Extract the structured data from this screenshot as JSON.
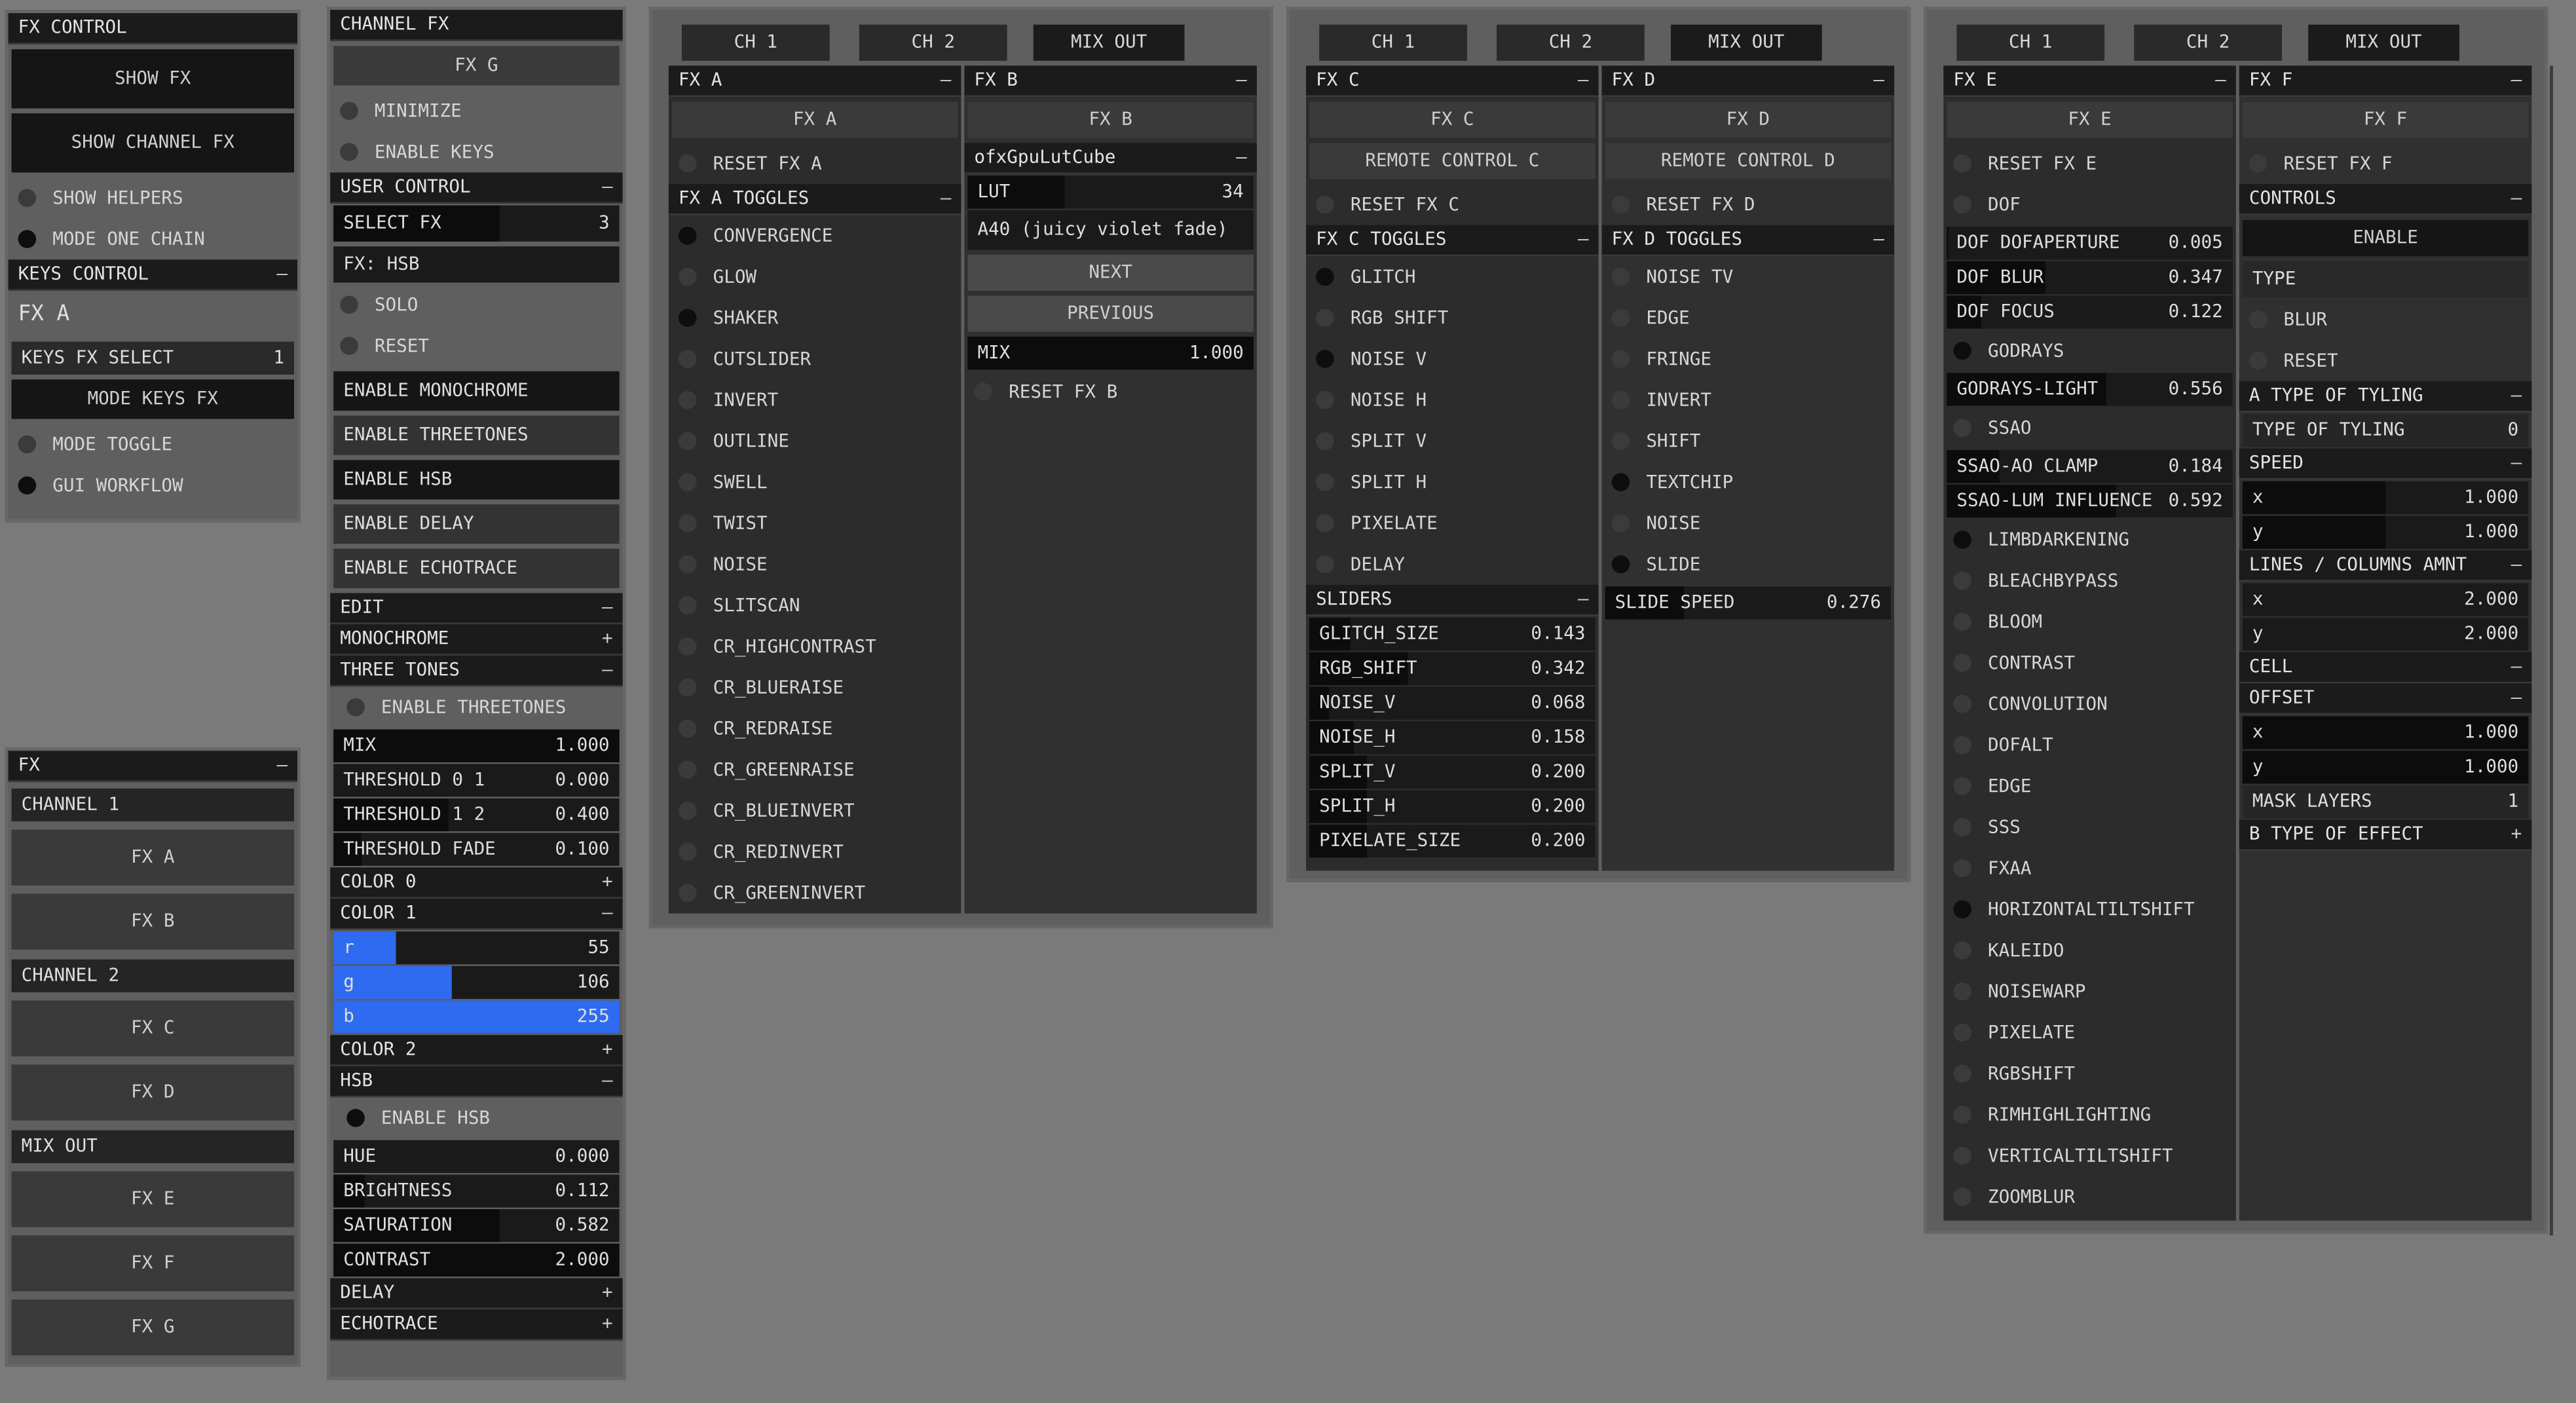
{
  "fx_control": {
    "title": "FX CONTROL",
    "show_fx": "SHOW FX",
    "show_channel_fx": "SHOW CHANNEL FX",
    "show_helpers": "SHOW HELPERS",
    "mode_one_chain": "MODE ONE CHAIN",
    "keys_control": "KEYS CONTROL",
    "keys_control_sign": "–",
    "fx_a_label": "FX A",
    "keys_fx_select": {
      "label": "KEYS FX SELECT",
      "value": "1"
    },
    "mode_keys_fx": "MODE KEYS FX",
    "mode_toggle": "MODE TOGGLE",
    "gui_workflow": "GUI WORKFLOW"
  },
  "fx_panel": {
    "title": "FX",
    "sign": "–",
    "channel_1": "CHANNEL 1",
    "fx_a": "FX A",
    "fx_b": "FX B",
    "channel_2": "CHANNEL 2",
    "fx_c": "FX C",
    "fx_d": "FX D",
    "mix_out": "MIX OUT",
    "fx_e": "FX E",
    "fx_f": "FX F",
    "fx_g": "FX G"
  },
  "channel_fx": {
    "title": "CHANNEL FX",
    "fx_g": "FX G",
    "minimize": "MINIMIZE",
    "enable_keys": "ENABLE KEYS",
    "user_control": "USER CONTROL",
    "user_control_sign": "–",
    "select_fx": {
      "label": "SELECT FX",
      "value": "3"
    },
    "fx_hsb": "FX: HSB",
    "solo": "SOLO",
    "reset": "RESET",
    "enable_monochrome": "ENABLE MONOCHROME",
    "enable_threetones": "ENABLE THREETONES",
    "enable_hsb": "ENABLE HSB",
    "enable_delay": "ENABLE DELAY",
    "enable_echotrace": "ENABLE ECHOTRACE",
    "edit": "EDIT",
    "edit_sign": "–",
    "monochrome": "MONOCHROME",
    "monochrome_sign": "+",
    "three_tones": "THREE TONES",
    "three_tones_sign": "–",
    "enable_threetones_toggle": "ENABLE THREETONES",
    "mix": {
      "label": "MIX",
      "value": "1.000",
      "fill": 1.0
    },
    "threshold01": {
      "label": "THRESHOLD 0 1",
      "value": "0.000",
      "fill": 0.0
    },
    "threshold12": {
      "label": "THRESHOLD 1 2",
      "value": "0.400",
      "fill": 0.4
    },
    "threshold_fade": {
      "label": "THRESHOLD FADE",
      "value": "0.100",
      "fill": 0.1
    },
    "color0": "COLOR 0",
    "color0_sign": "+",
    "color1": "COLOR 1",
    "color1_sign": "–",
    "r": {
      "label": "r",
      "value": "55",
      "fill": 0.216
    },
    "g": {
      "label": "g",
      "value": "106",
      "fill": 0.416
    },
    "b": {
      "label": "b",
      "value": "255",
      "fill": 1.0
    },
    "color2": "COLOR 2",
    "color2_sign": "+",
    "hsb": "HSB",
    "hsb_sign": "–",
    "enable_hsb_toggle": "ENABLE HSB",
    "hue": {
      "label": "HUE",
      "value": "0.000",
      "fill": 0.0
    },
    "brightness": {
      "label": "BRIGHTNESS",
      "value": "0.112",
      "fill": 0.112
    },
    "saturation": {
      "label": "SATURATION",
      "value": "0.582",
      "fill": 0.582
    },
    "contrast": {
      "label": "CONTRAST",
      "value": "2.000",
      "fill": 1.0
    },
    "delay": "DELAY",
    "delay_sign": "+",
    "echotrace": "ECHOTRACE",
    "echotrace_sign": "+"
  },
  "tabs": {
    "ch1": "CH 1",
    "ch2": "CH 2",
    "mixout": "MIX OUT"
  },
  "fxa": {
    "title": "FX A",
    "sign": "–",
    "button": "FX A",
    "reset": "RESET FX A",
    "toggles_title": "FX A TOGGLES",
    "toggles_sign": "–",
    "toggles": [
      {
        "label": "CONVERGENCE",
        "on": true
      },
      {
        "label": "GLOW",
        "on": false
      },
      {
        "label": "SHAKER",
        "on": true
      },
      {
        "label": "CUTSLIDER",
        "on": false
      },
      {
        "label": "INVERT",
        "on": false
      },
      {
        "label": "OUTLINE",
        "on": false
      },
      {
        "label": "SWELL",
        "on": false
      },
      {
        "label": "TWIST",
        "on": false
      },
      {
        "label": "NOISE",
        "on": false
      },
      {
        "label": "SLITSCAN",
        "on": false
      },
      {
        "label": "CR_HIGHCONTRAST",
        "on": false
      },
      {
        "label": "CR_BLUERAISE",
        "on": false
      },
      {
        "label": "CR_REDRAISE",
        "on": false
      },
      {
        "label": "CR_GREENRAISE",
        "on": false
      },
      {
        "label": "CR_BLUEINVERT",
        "on": false
      },
      {
        "label": "CR_REDINVERT",
        "on": false
      },
      {
        "label": "CR_GREENINVERT",
        "on": false
      }
    ]
  },
  "fxb": {
    "title": "FX B",
    "sign": "–",
    "button": "FX B",
    "lut_cube": "ofxGpuLutCube",
    "lut_cube_sign": "–",
    "lut": {
      "label": "LUT",
      "value": "34",
      "fill": 0.34
    },
    "lut_name": "A40 (juicy violet fade)",
    "next": "NEXT",
    "previous": "PREVIOUS",
    "mix": {
      "label": "MIX",
      "value": "1.000",
      "fill": 1.0
    },
    "reset": "RESET FX B"
  },
  "fxc": {
    "title": "FX C",
    "sign": "–",
    "button": "FX C",
    "remote": "REMOTE CONTROL C",
    "reset": "RESET FX C",
    "toggles_title": "FX C TOGGLES",
    "toggles_sign": "–",
    "toggles": [
      {
        "label": "GLITCH",
        "on": true
      },
      {
        "label": "RGB SHIFT",
        "on": false
      },
      {
        "label": "NOISE V",
        "on": true
      },
      {
        "label": "NOISE H",
        "on": false
      },
      {
        "label": "SPLIT V",
        "on": false
      },
      {
        "label": "SPLIT H",
        "on": false
      },
      {
        "label": "PIXELATE",
        "on": false
      },
      {
        "label": "DELAY",
        "on": false
      }
    ],
    "sliders_title": "SLIDERS",
    "sliders_sign": "–",
    "sliders": [
      {
        "label": "GLITCH_SIZE",
        "value": "0.143",
        "fill": 0.143
      },
      {
        "label": "RGB_SHIFT",
        "value": "0.342",
        "fill": 0.342
      },
      {
        "label": "NOISE_V",
        "value": "0.068",
        "fill": 0.068
      },
      {
        "label": "NOISE_H",
        "value": "0.158",
        "fill": 0.158
      },
      {
        "label": "SPLIT_V",
        "value": "0.200",
        "fill": 0.2
      },
      {
        "label": "SPLIT_H",
        "value": "0.200",
        "fill": 0.2
      },
      {
        "label": "PIXELATE_SIZE",
        "value": "0.200",
        "fill": 0.2
      }
    ]
  },
  "fxd": {
    "title": "FX D",
    "sign": "–",
    "button": "FX D",
    "remote": "REMOTE CONTROL D",
    "reset": "RESET FX D",
    "toggles_title": "FX D TOGGLES",
    "toggles_sign": "–",
    "toggles": [
      {
        "label": "NOISE TV",
        "on": false
      },
      {
        "label": "EDGE",
        "on": false
      },
      {
        "label": "FRINGE",
        "on": false
      },
      {
        "label": "INVERT",
        "on": false
      },
      {
        "label": "SHIFT",
        "on": false
      },
      {
        "label": "TEXTCHIP",
        "on": true
      },
      {
        "label": "NOISE",
        "on": false
      },
      {
        "label": "SLIDE",
        "on": true
      }
    ],
    "slide_speed": {
      "label": "SLIDE SPEED",
      "value": "0.276",
      "fill": 0.276
    }
  },
  "fxe": {
    "title": "FX E",
    "sign": "–",
    "button": "FX E",
    "reset": "RESET FX E",
    "dof": "DOF",
    "params1": [
      {
        "label": "DOF DOFAPERTURE",
        "value": "0.005",
        "fill": 0.005
      },
      {
        "label": "DOF BLUR",
        "value": "0.347",
        "fill": 0.347
      },
      {
        "label": "DOF FOCUS",
        "value": "0.122",
        "fill": 0.122
      }
    ],
    "godrays": "GODRAYS",
    "godrays_light": {
      "label": "GODRAYS-LIGHT",
      "value": "0.556",
      "fill": 0.556
    },
    "ssao": "SSAO",
    "params2": [
      {
        "label": "SSAO-AO CLAMP",
        "value": "0.184",
        "fill": 0.184
      },
      {
        "label": "SSAO-LUM INFLUENCE",
        "value": "0.592",
        "fill": 0.592
      }
    ],
    "toggles": [
      {
        "label": "LIMBDARKENING",
        "on": true
      },
      {
        "label": "BLEACHBYPASS",
        "on": false
      },
      {
        "label": "BLOOM",
        "on": false
      },
      {
        "label": "CONTRAST",
        "on": false
      },
      {
        "label": "CONVOLUTION",
        "on": false
      },
      {
        "label": "DOFALT",
        "on": false
      },
      {
        "label": "EDGE",
        "on": false
      },
      {
        "label": "SSS",
        "on": false
      },
      {
        "label": "FXAA",
        "on": false
      },
      {
        "label": "HORIZONTALTILTSHIFT",
        "on": true
      },
      {
        "label": "KALEIDO",
        "on": false
      },
      {
        "label": "NOISEWARP",
        "on": false
      },
      {
        "label": "PIXELATE",
        "on": false
      },
      {
        "label": "RGBSHIFT",
        "on": false
      },
      {
        "label": "RIMHIGHLIGHTING",
        "on": false
      },
      {
        "label": "VERTICALTILTSHIFT",
        "on": false
      },
      {
        "label": "ZOOMBLUR",
        "on": false
      }
    ]
  },
  "fxf": {
    "title": "FX F",
    "sign": "–",
    "button": "FX F",
    "reset": "RESET FX F",
    "controls": "CONTROLS",
    "controls_sign": "–",
    "enable": "ENABLE",
    "type": "TYPE",
    "blur": "BLUR",
    "reset2": "RESET",
    "a_type": "A TYPE OF TYLING",
    "a_type_sign": "–",
    "type_of_tyling": {
      "label": "TYPE OF TYLING",
      "value": "0"
    },
    "speed": "SPEED",
    "speed_sign": "–",
    "speed_x": {
      "label": "x",
      "value": "1.000",
      "fill": 0.5
    },
    "speed_y": {
      "label": "y",
      "value": "1.000",
      "fill": 0.5
    },
    "lines": "LINES / COLUMNS AMNT",
    "lines_sign": "–",
    "lines_x": {
      "label": "x",
      "value": "2.000",
      "fill": 0.0
    },
    "lines_y": {
      "label": "y",
      "value": "2.000",
      "fill": 0.0
    },
    "cell": "CELL",
    "cell_sign": "–",
    "offset": "OFFSET",
    "offset_sign": "–",
    "offset_x": {
      "label": "x",
      "value": "1.000",
      "fill": 1.0
    },
    "offset_y": {
      "label": "y",
      "value": "1.000",
      "fill": 1.0
    },
    "mask_layers": {
      "label": "MASK LAYERS",
      "value": "1"
    },
    "b_type": "B TYPE OF EFFECT",
    "b_type_sign": "+"
  }
}
